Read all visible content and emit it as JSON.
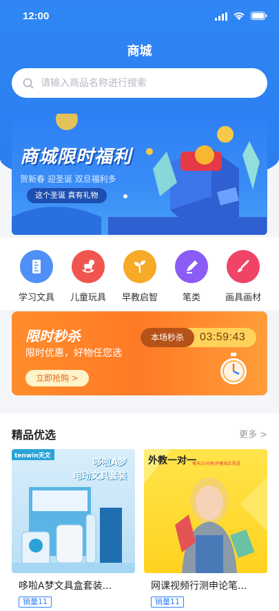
{
  "status": {
    "time": "12:00"
  },
  "header": {
    "title": "商城"
  },
  "search": {
    "placeholder": "请输入商品名称进行搜索"
  },
  "banner": {
    "title": "商城限时福利",
    "subtitle": "贺新春 迎圣诞 双旦福利多",
    "pill": "这个圣诞 真有礼物"
  },
  "categories": [
    {
      "label": "学习文具",
      "color": "#3b82f6",
      "icon": "ruler-icon"
    },
    {
      "label": "儿童玩具",
      "color": "#ef4444",
      "icon": "rocking-horse-icon"
    },
    {
      "label": "早教启智",
      "color": "#f59e0b",
      "icon": "sprout-icon"
    },
    {
      "label": "笔类",
      "color": "#8b5cf6",
      "icon": "pen-icon"
    },
    {
      "label": "画具画材",
      "color": "#e11d48",
      "icon": "brush-icon"
    }
  ],
  "flash_sale": {
    "title": "限时秒杀",
    "subtitle": "限时优惠，好物任您选",
    "button": "立即抢购 >",
    "timer_label": "本场秒杀",
    "timer_value": "03:59:43"
  },
  "featured": {
    "title": "精品优选",
    "more": "更多 >",
    "items": [
      {
        "name": "哆啦A梦文具盒套装...",
        "badge": "销量11",
        "img_brand": "tenwin天文",
        "img_title": "哆啦A梦",
        "img_sub": "电动文具套装"
      },
      {
        "name": "网课视频行测申论笔...",
        "badge": "销量11",
        "img_title": "外教一对一",
        "img_sub": "每天25分钟/外教纯正英语"
      }
    ]
  }
}
